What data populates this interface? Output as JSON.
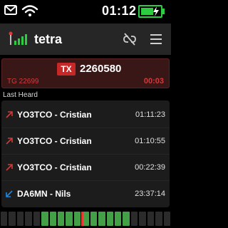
{
  "status_bar": {
    "time": "01:12",
    "icons": [
      "mail-icon",
      "wifi-icon",
      "battery-icon",
      "charging-bolt-icon"
    ],
    "battery_level": 0.6,
    "battery_color": "#2ecc40"
  },
  "header": {
    "title": "tetra",
    "icons": [
      "antenna-signal-icon",
      "unlink-icon",
      "hamburger-menu-icon"
    ],
    "accent": "#2ecc40"
  },
  "tx": {
    "badge": "TX",
    "id": "2260580",
    "talkgroup": "TG 22699",
    "timer": "00:03",
    "color": "#c62828"
  },
  "last_heard": {
    "label": "Last Heard",
    "items": [
      {
        "name": "YO3TCO - Cristian",
        "time": "01:11:23",
        "direction": "outgoing",
        "icon": "arrow-up-right-icon",
        "color": "#d23a3a"
      },
      {
        "name": "YO3TCO - Cristian",
        "time": "01:10:55",
        "direction": "outgoing",
        "icon": "arrow-up-right-icon",
        "color": "#d23a3a"
      },
      {
        "name": "YO3TCO - Cristian",
        "time": "00:22:39",
        "direction": "outgoing",
        "icon": "arrow-up-right-icon",
        "color": "#d23a3a"
      },
      {
        "name": "DA6MN - Nils",
        "time": "23:37:14",
        "direction": "incoming",
        "icon": "arrow-down-left-icon",
        "color": "#1e88e5"
      }
    ]
  },
  "level_meter": {
    "segments": [
      "off",
      "off",
      "off",
      "off",
      "off",
      "on",
      "on",
      "on",
      "on",
      "on",
      "on",
      "on",
      "on",
      "on",
      "on",
      "on",
      "off",
      "off",
      "off",
      "off",
      "off"
    ],
    "marker_value": 0.48,
    "on_color": "#43a047",
    "off_color": "#2b2b2b",
    "marker_color": "#e53935"
  }
}
